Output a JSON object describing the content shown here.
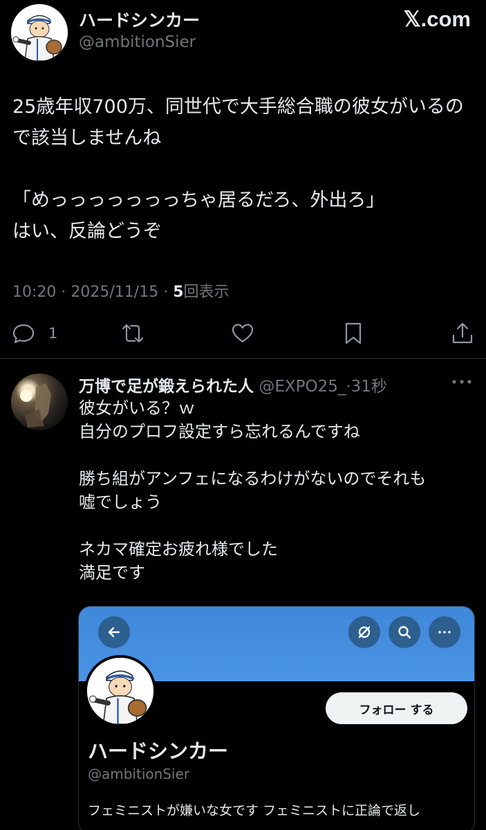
{
  "brand": {
    "site_label": "𝕏.com"
  },
  "main_tweet": {
    "author_name": "ハードシンカー",
    "author_handle": "@ambitionSier",
    "body": [
      "25歳年収700万、同世代で大手総合職の彼女がいるので該当しませんね",
      "",
      "「めっっっっっっっちゃ居るだろ、外出ろ」\nはい、反論どうぞ"
    ],
    "time": "10:20",
    "date": "2025/11/15",
    "views_count": "5",
    "views_label": "回表示",
    "separator": "·"
  },
  "actions": {
    "reply_count": "1",
    "icons": [
      "reply-icon",
      "retweet-icon",
      "like-icon",
      "bookmark-icon",
      "share-icon"
    ]
  },
  "reply": {
    "author_name": "万博で足が鍛えられた人",
    "author_handle": "@EXPO25_",
    "separator": "·",
    "time": "31秒",
    "text": "彼女がいる？ｗ\n自分のプロフ設定すら忘れるんですね\n\n勝ち組がアンフェになるわけがないのでそれも\n嘘でしょう\n\nネカマ確定お疲れ様でした\n満足です"
  },
  "embedded_profile": {
    "follow_label": "フォロー する",
    "name": "ハードシンカー",
    "handle": "@ambitionSier",
    "bio": "フェミニストが嫌いな女です フェミニストに正論で返し",
    "colors": {
      "banner": "#4a94e6",
      "button_bg": "#2d5f8f"
    }
  }
}
